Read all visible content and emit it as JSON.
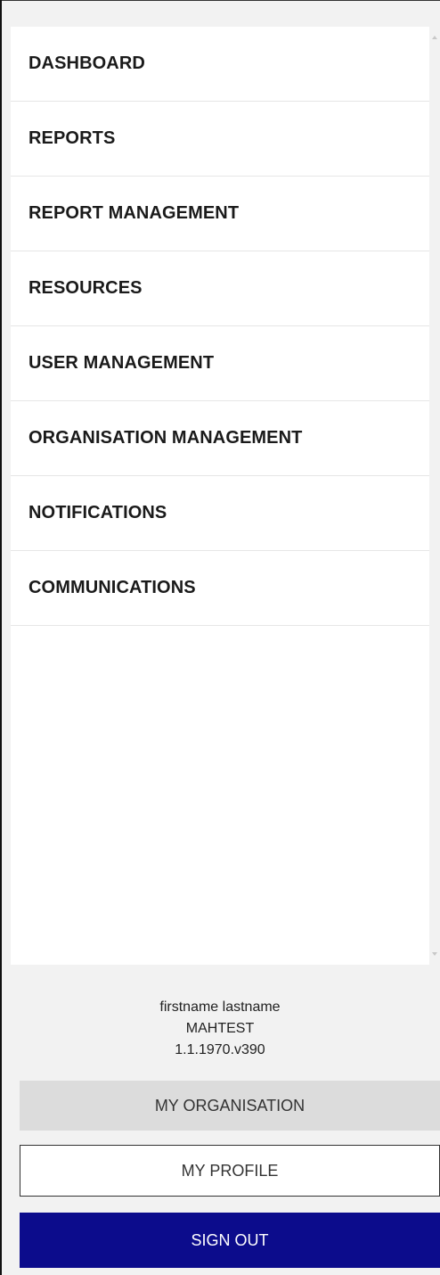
{
  "nav": {
    "items": [
      {
        "id": "dashboard",
        "label": "DASHBOARD"
      },
      {
        "id": "reports",
        "label": "REPORTS"
      },
      {
        "id": "report-management",
        "label": "REPORT MANAGEMENT"
      },
      {
        "id": "resources",
        "label": "RESOURCES"
      },
      {
        "id": "user-management",
        "label": "USER MANAGEMENT"
      },
      {
        "id": "organisation-management",
        "label": "ORGANISATION MANAGEMENT"
      },
      {
        "id": "notifications",
        "label": "NOTIFICATIONS"
      },
      {
        "id": "communications",
        "label": "COMMUNICATIONS"
      }
    ]
  },
  "user": {
    "name": "firstname lastname",
    "organisation": "MAHTEST",
    "version": "1.1.1970.v390"
  },
  "actions": {
    "my_organisation_label": "MY ORGANISATION",
    "my_profile_label": "MY PROFILE",
    "sign_out_label": "SIGN OUT"
  },
  "colors": {
    "background": "#f2f2f2",
    "panel": "#ffffff",
    "sign_out_bg": "#0c0c8c",
    "my_organisation_bg": "#dcdcdc"
  }
}
